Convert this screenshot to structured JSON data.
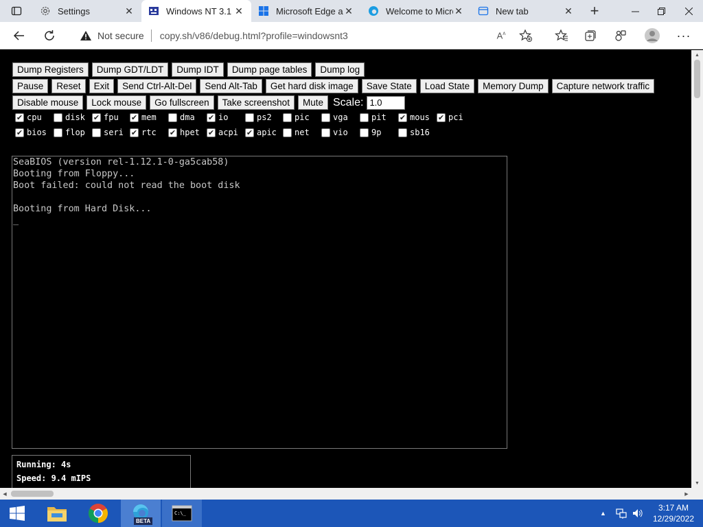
{
  "browser": {
    "tabs": [
      {
        "label": "Settings",
        "icon": "gear-icon",
        "active": false
      },
      {
        "label": "Windows NT 3.1 -",
        "icon": "v86-icon",
        "active": true
      },
      {
        "label": "Microsoft Edge ar",
        "icon": "windows-icon",
        "active": false
      },
      {
        "label": "Welcome to Micro",
        "icon": "edge-icon",
        "active": false
      },
      {
        "label": "New tab",
        "icon": "newtab-icon",
        "active": false
      }
    ],
    "address": {
      "security_label": "Not secure",
      "url": "copy.sh/v86/debug.html?profile=windowsnt3"
    }
  },
  "toolbar_rows": [
    [
      "Dump Registers",
      "Dump GDT/LDT",
      "Dump IDT",
      "Dump page tables",
      "Dump log"
    ],
    [
      "Pause",
      "Reset",
      "Exit",
      "Send Ctrl-Alt-Del",
      "Send Alt-Tab",
      "Get hard disk image",
      "Save State",
      "Load State",
      "Memory Dump",
      "Capture network traffic"
    ],
    [
      "Disable mouse",
      "Lock mouse",
      "Go fullscreen",
      "Take screenshot",
      "Mute"
    ]
  ],
  "scale": {
    "label": "Scale:",
    "value": "1.0"
  },
  "log_flags": [
    [
      {
        "name": "cpu",
        "checked": true
      },
      {
        "name": "disk",
        "checked": false
      },
      {
        "name": "fpu",
        "checked": true
      },
      {
        "name": "mem",
        "checked": true
      },
      {
        "name": "dma",
        "checked": false
      },
      {
        "name": "io",
        "checked": true
      },
      {
        "name": "ps2",
        "checked": false
      },
      {
        "name": "pic",
        "checked": false
      },
      {
        "name": "vga",
        "checked": false
      },
      {
        "name": "pit",
        "checked": false
      },
      {
        "name": "mous",
        "checked": true
      },
      {
        "name": "pci",
        "checked": true
      }
    ],
    [
      {
        "name": "bios",
        "checked": true
      },
      {
        "name": "flop",
        "checked": false
      },
      {
        "name": "seri",
        "checked": false
      },
      {
        "name": "rtc",
        "checked": true
      },
      {
        "name": "hpet",
        "checked": true
      },
      {
        "name": "acpi",
        "checked": true
      },
      {
        "name": "apic",
        "checked": true
      },
      {
        "name": "net",
        "checked": false
      },
      {
        "name": "vio",
        "checked": false
      },
      {
        "name": "9p",
        "checked": false
      },
      {
        "name": "sb16",
        "checked": false
      }
    ]
  ],
  "screen": {
    "text": "SeaBIOS (version rel-1.12.1-0-ga5cab58)\nBooting from Floppy...\nBoot failed: could not read the boot disk\n\nBooting from Hard Disk...\n_"
  },
  "stats": {
    "running": "Running: 4s",
    "speed": "Speed: 9.4 mIPS"
  },
  "taskbar": {
    "items": [
      "start-icon",
      "file-explorer-icon",
      "chrome-icon",
      "edge-beta-icon",
      "command-prompt-icon"
    ],
    "edge_badge": "BETA",
    "time": "3:17 AM",
    "date": "12/29/2022"
  }
}
